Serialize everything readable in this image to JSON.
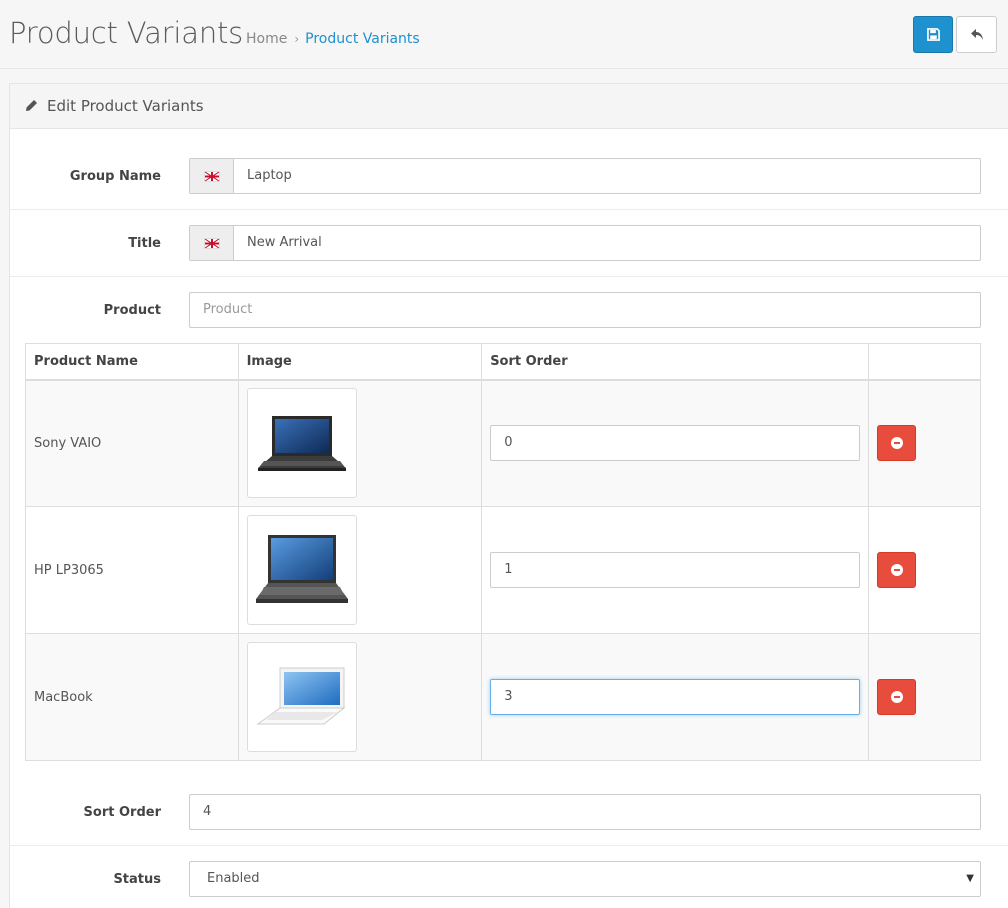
{
  "header": {
    "title": "Product Variants",
    "breadcrumb": [
      {
        "label": "Home"
      },
      {
        "label": "Product Variants"
      }
    ],
    "save_icon": "floppy-disk-icon",
    "back_icon": "reply-arrow-icon"
  },
  "panel": {
    "heading_icon": "pencil-icon",
    "heading": "Edit Product Variants"
  },
  "form": {
    "group_name": {
      "label": "Group Name",
      "value": "Laptop",
      "language_icon": "uk-flag-icon"
    },
    "title": {
      "label": "Title",
      "value": "New Arrival",
      "language_icon": "uk-flag-icon"
    },
    "product": {
      "label": "Product",
      "placeholder": "Product"
    },
    "table": {
      "headers": [
        "Product Name",
        "Image",
        "Sort Order",
        ""
      ],
      "rows": [
        {
          "name": "Sony VAIO",
          "image": "black-laptop-image",
          "sort_order": "0"
        },
        {
          "name": "HP LP3065",
          "image": "grey-laptop-image",
          "sort_order": "1"
        },
        {
          "name": "MacBook",
          "image": "white-laptop-image",
          "sort_order": "3"
        }
      ],
      "remove_icon": "minus-circle-icon"
    },
    "sort_order": {
      "label": "Sort Order",
      "value": "4"
    },
    "status": {
      "label": "Status",
      "value": "Enabled"
    }
  },
  "colors": {
    "primary": "#1e91cf",
    "danger": "#e74c3c",
    "link": "#1e91cf"
  }
}
